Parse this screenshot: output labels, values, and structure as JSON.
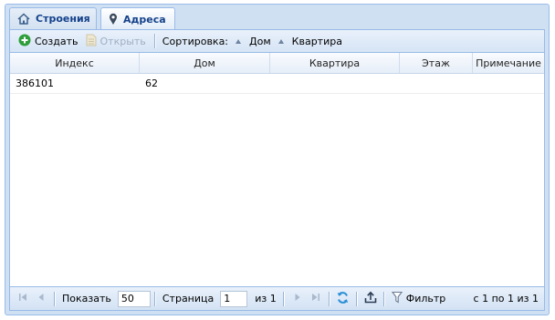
{
  "tabs": [
    {
      "label": "Строения",
      "icon": "home-icon",
      "active": false
    },
    {
      "label": "Адреса",
      "icon": "map-pin-icon",
      "active": true
    }
  ],
  "toolbar": {
    "create_label": "Создать",
    "open_label": "Открыть",
    "sort_label": "Сортировка:",
    "sort_house_label": "Дом",
    "sort_apartment_label": "Квартира"
  },
  "grid": {
    "columns": [
      "Индекс",
      "Дом",
      "Квартира",
      "Этаж",
      "Примечание"
    ],
    "rows": [
      [
        "386101",
        "62",
        "",
        "",
        ""
      ]
    ]
  },
  "pager": {
    "show_label": "Показать",
    "page_size": "50",
    "page_label": "Страница",
    "page_value": "1",
    "of_label": "из 1",
    "filter_label": "Фильтр",
    "summary": "с 1 по 1 из 1"
  },
  "colors": {
    "panel_bg": "#cfe0f3",
    "border": "#99bbe8",
    "tab_text": "#15428b",
    "create_icon": "#2e9e3a",
    "refresh_icon": "#2a8fd6"
  }
}
